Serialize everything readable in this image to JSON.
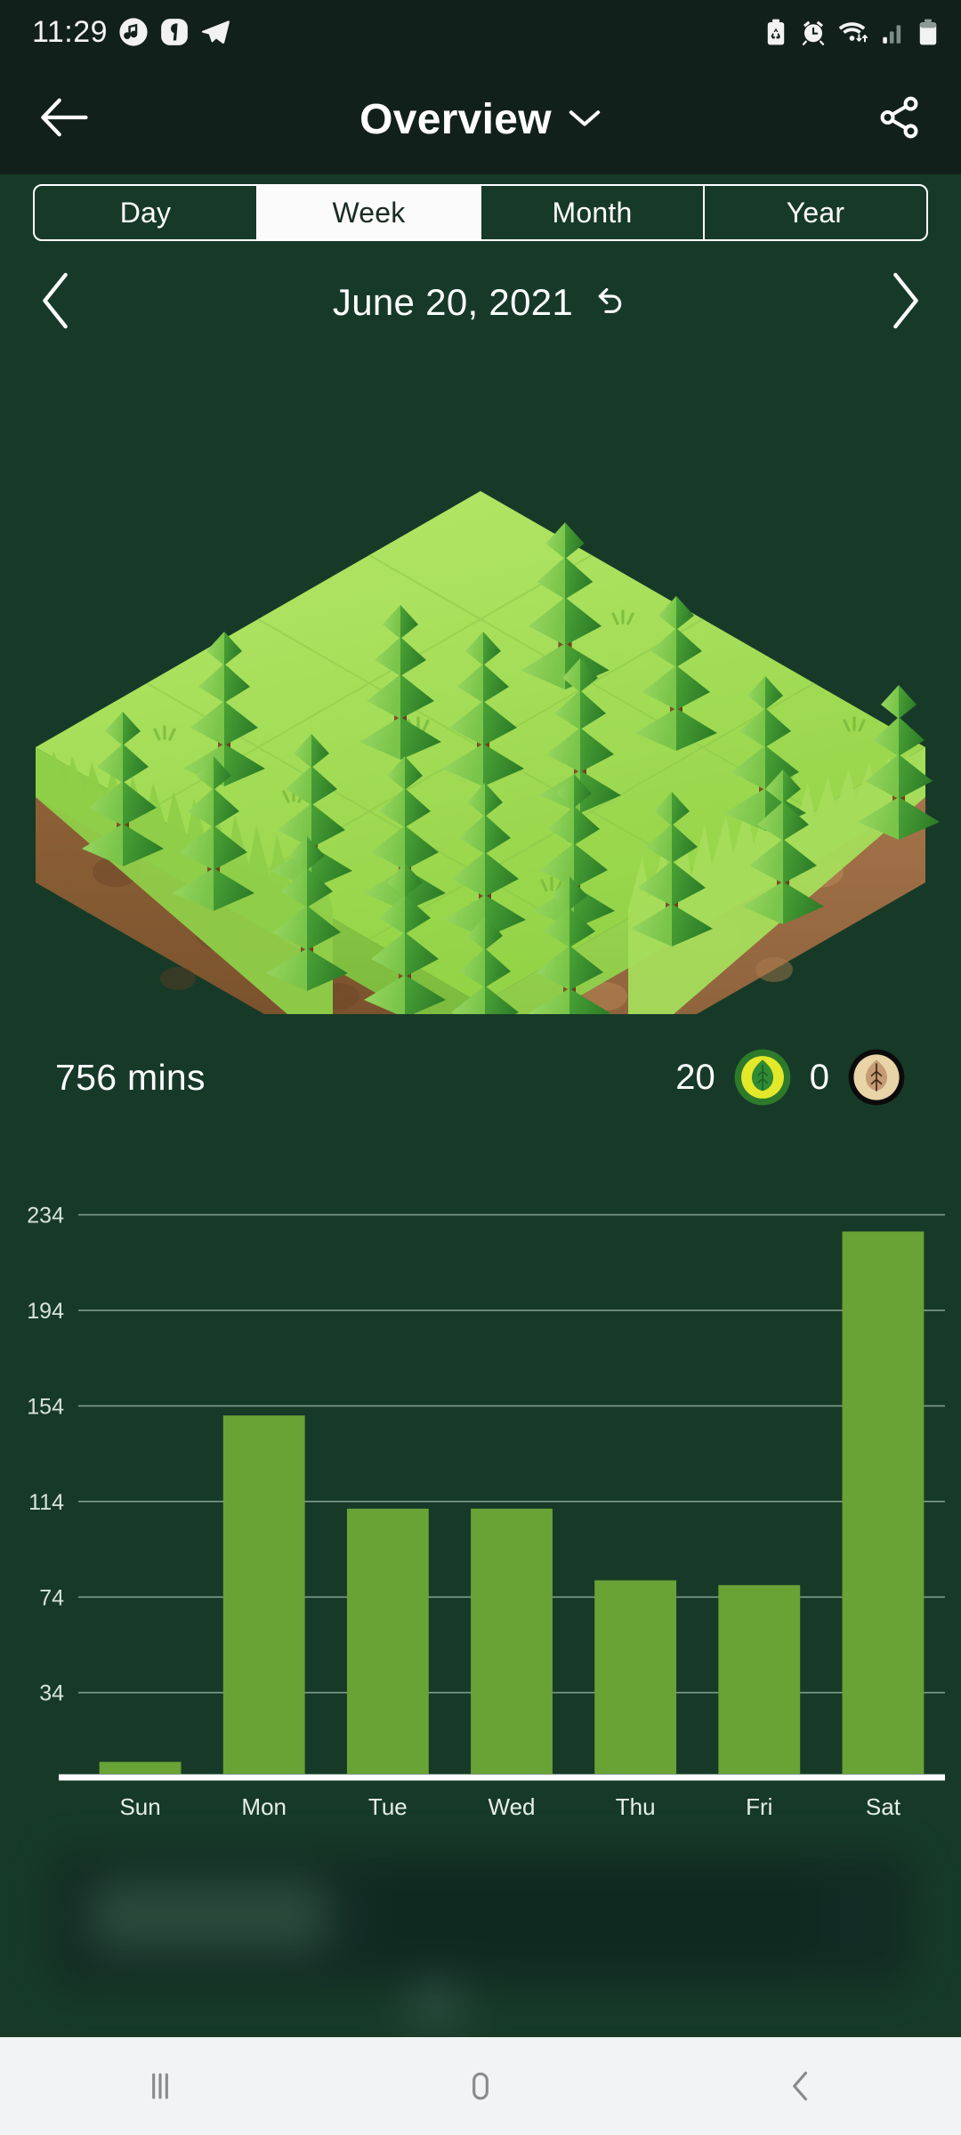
{
  "status_bar": {
    "time": "11:29",
    "left_icons": [
      "music-note-icon",
      "app-badge-icon",
      "telegram-icon"
    ],
    "right_icons": [
      "battery-saver-icon",
      "alarm-icon",
      "wifi-icon",
      "cellular-signal-icon",
      "battery-icon"
    ]
  },
  "app_bar": {
    "back_icon": "back-arrow-icon",
    "title": "Overview",
    "dropdown_icon": "chevron-down-icon",
    "share_icon": "share-icon"
  },
  "tabs": {
    "items": [
      {
        "label": "Day",
        "active": false
      },
      {
        "label": "Week",
        "active": true
      },
      {
        "label": "Month",
        "active": false
      },
      {
        "label": "Year",
        "active": false
      }
    ]
  },
  "date_nav": {
    "prev_icon": "chevron-left-icon",
    "label": "June 20, 2021",
    "reset_icon": "undo-arrow-icon",
    "next_icon": "chevron-right-icon"
  },
  "illustration": {
    "name": "isometric-forest-island",
    "tree_count": 20,
    "grass_color": "#9ada4f",
    "grass_top_color": "#a9e35e",
    "soil_color": "#8d6239",
    "tree_dark": "#3f9330",
    "tree_light": "#8ed05a",
    "trunk_color": "#7a4d1e"
  },
  "stats": {
    "total_minutes_label": "756 mins",
    "healthy_trees": "20",
    "healthy_badge_icon": "green-leaf-badge-icon",
    "dead_trees": "0",
    "dead_badge_icon": "dead-leaf-badge-icon"
  },
  "chart_data": {
    "type": "bar",
    "title": "",
    "xlabel": "",
    "ylabel": "",
    "categories": [
      "Sun",
      "Mon",
      "Tue",
      "Wed",
      "Thu",
      "Fri",
      "Sat"
    ],
    "values": [
      5,
      150,
      111,
      111,
      81,
      79,
      227
    ],
    "ytick_labels": [
      "234",
      "194",
      "154",
      "114",
      "74",
      "34"
    ],
    "ytick_values": [
      234,
      194,
      154,
      114,
      74,
      34
    ],
    "ylim": [
      0,
      248
    ],
    "grid": true,
    "legend": "none",
    "bar_color": "#69a235",
    "grid_color": "#7f9b8b",
    "axis_color": "#ffffff"
  },
  "nav_bar": {
    "recents_icon": "recents-icon",
    "home_icon": "home-icon",
    "back_icon": "nav-back-icon"
  },
  "colors": {
    "background": "#173a28",
    "chrome": "#12201c",
    "accent": "#69a235",
    "text": "#ffffff"
  }
}
